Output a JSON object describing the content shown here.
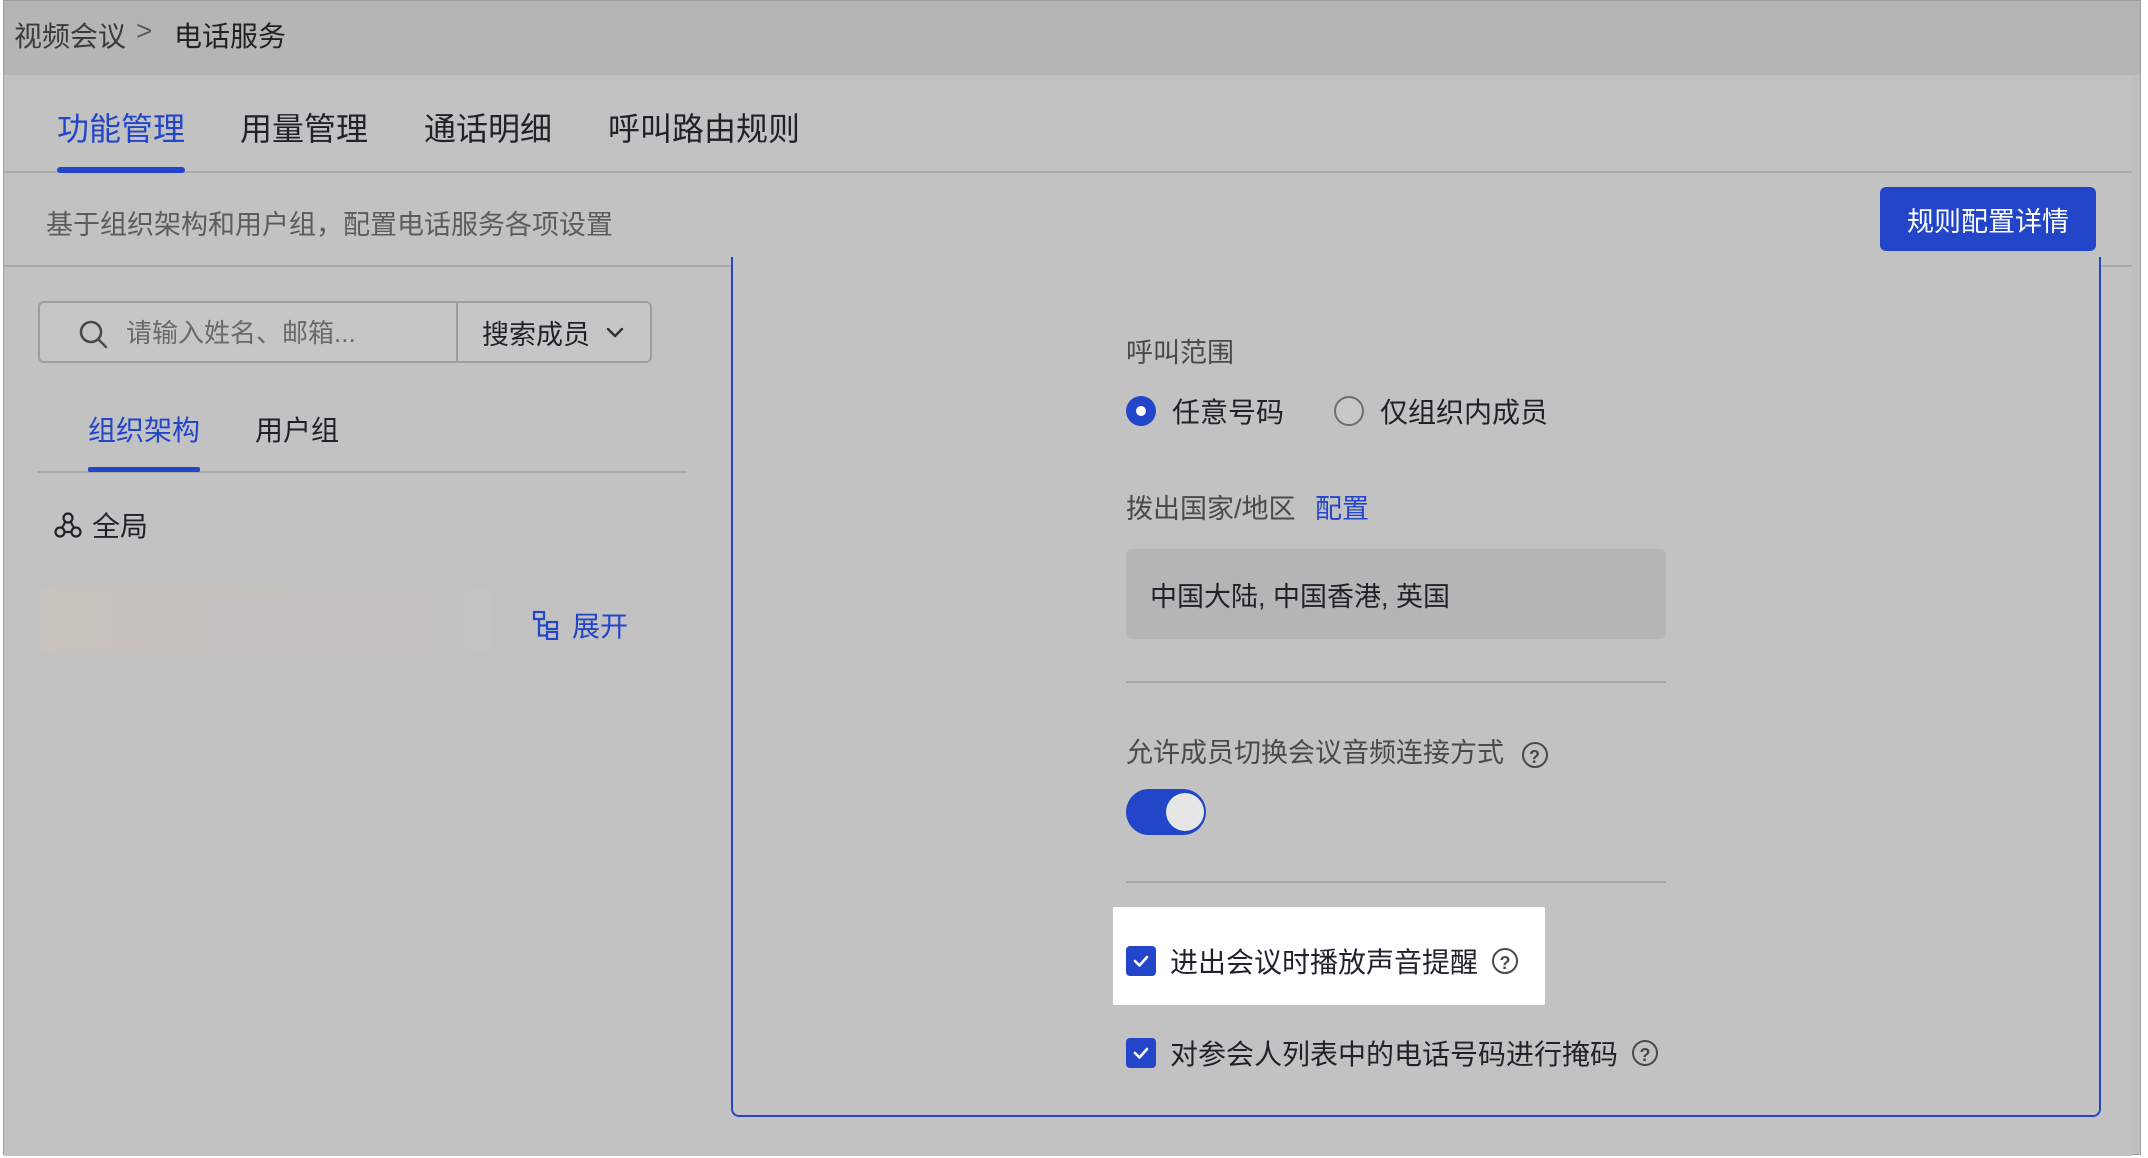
{
  "breadcrumb": {
    "parent": "视频会议",
    "separator": ">",
    "current": "电话服务"
  },
  "tabs": [
    {
      "label": "功能管理",
      "active": true
    },
    {
      "label": "用量管理",
      "active": false
    },
    {
      "label": "通话明细",
      "active": false
    },
    {
      "label": "呼叫路由规则",
      "active": false
    }
  ],
  "description": "基于组织架构和用户组，配置电话服务各项设置",
  "detail_button": "规则配置详情",
  "sidebar": {
    "search_placeholder": "请输入姓名、邮箱...",
    "search_scope": "搜索成员",
    "subtabs": [
      {
        "label": "组织架构",
        "active": true
      },
      {
        "label": "用户组",
        "active": false
      }
    ],
    "global_label": "全局",
    "expand_label": "展开"
  },
  "settings": {
    "call_range_label": "呼叫范围",
    "call_range_options": [
      {
        "label": "任意号码",
        "selected": true
      },
      {
        "label": "仅组织内成员",
        "selected": false
      }
    ],
    "dial_region_label": "拨出国家/地区",
    "dial_region_config": "配置",
    "dial_region_value": "中国大陆, 中国香港, 英国",
    "audio_switch_label": "允许成员切换会议音频连接方式",
    "audio_switch_on": true,
    "join_sound_label": "进出会议时播放声音提醒",
    "join_sound_checked": true,
    "mask_numbers_label": "对参会人列表中的电话号码进行掩码",
    "mask_numbers_checked": true,
    "help_glyph": "?"
  },
  "colors": {
    "accent": "#2245c9",
    "overlay_gray": "#c2c2c2",
    "highlight": "#ffffff"
  }
}
